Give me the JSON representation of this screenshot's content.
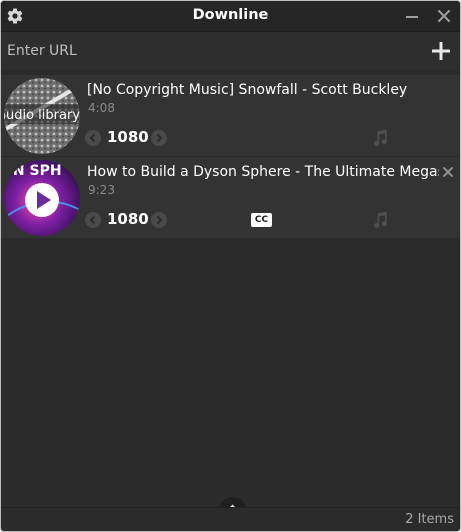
{
  "app": {
    "title": "Downline",
    "icons": [
      "gear-icon",
      "minimize-icon",
      "close-icon",
      "plus-icon",
      "chevron-up-icon"
    ]
  },
  "url_bar": {
    "placeholder": "Enter URL",
    "value": ""
  },
  "items": [
    {
      "title": "[No Copyright Music] Snowfall - Scott Buckley",
      "duration": "4:08",
      "quality": "1080",
      "thumbnail_text": "audio library",
      "has_captions": false,
      "icons": [
        "chevron-left-icon",
        "chevron-right-icon",
        "music-note-icon"
      ]
    },
    {
      "title": "How to Build a Dyson Sphere - The Ultimate Megas",
      "duration": "9:23",
      "quality": "1080",
      "thumbnail_text": "ON SPH",
      "has_captions": true,
      "captions_label": "CC",
      "icons": [
        "chevron-left-icon",
        "chevron-right-icon",
        "music-note-icon",
        "close-icon"
      ]
    }
  ],
  "status": {
    "count_label": "2 Items"
  },
  "colors": {
    "window_bg": "#2b2b2b",
    "item_bg": "#333333",
    "titlebar_bg": "#262626",
    "text": "#ffffff",
    "muted_text": "#8a8a8a"
  }
}
